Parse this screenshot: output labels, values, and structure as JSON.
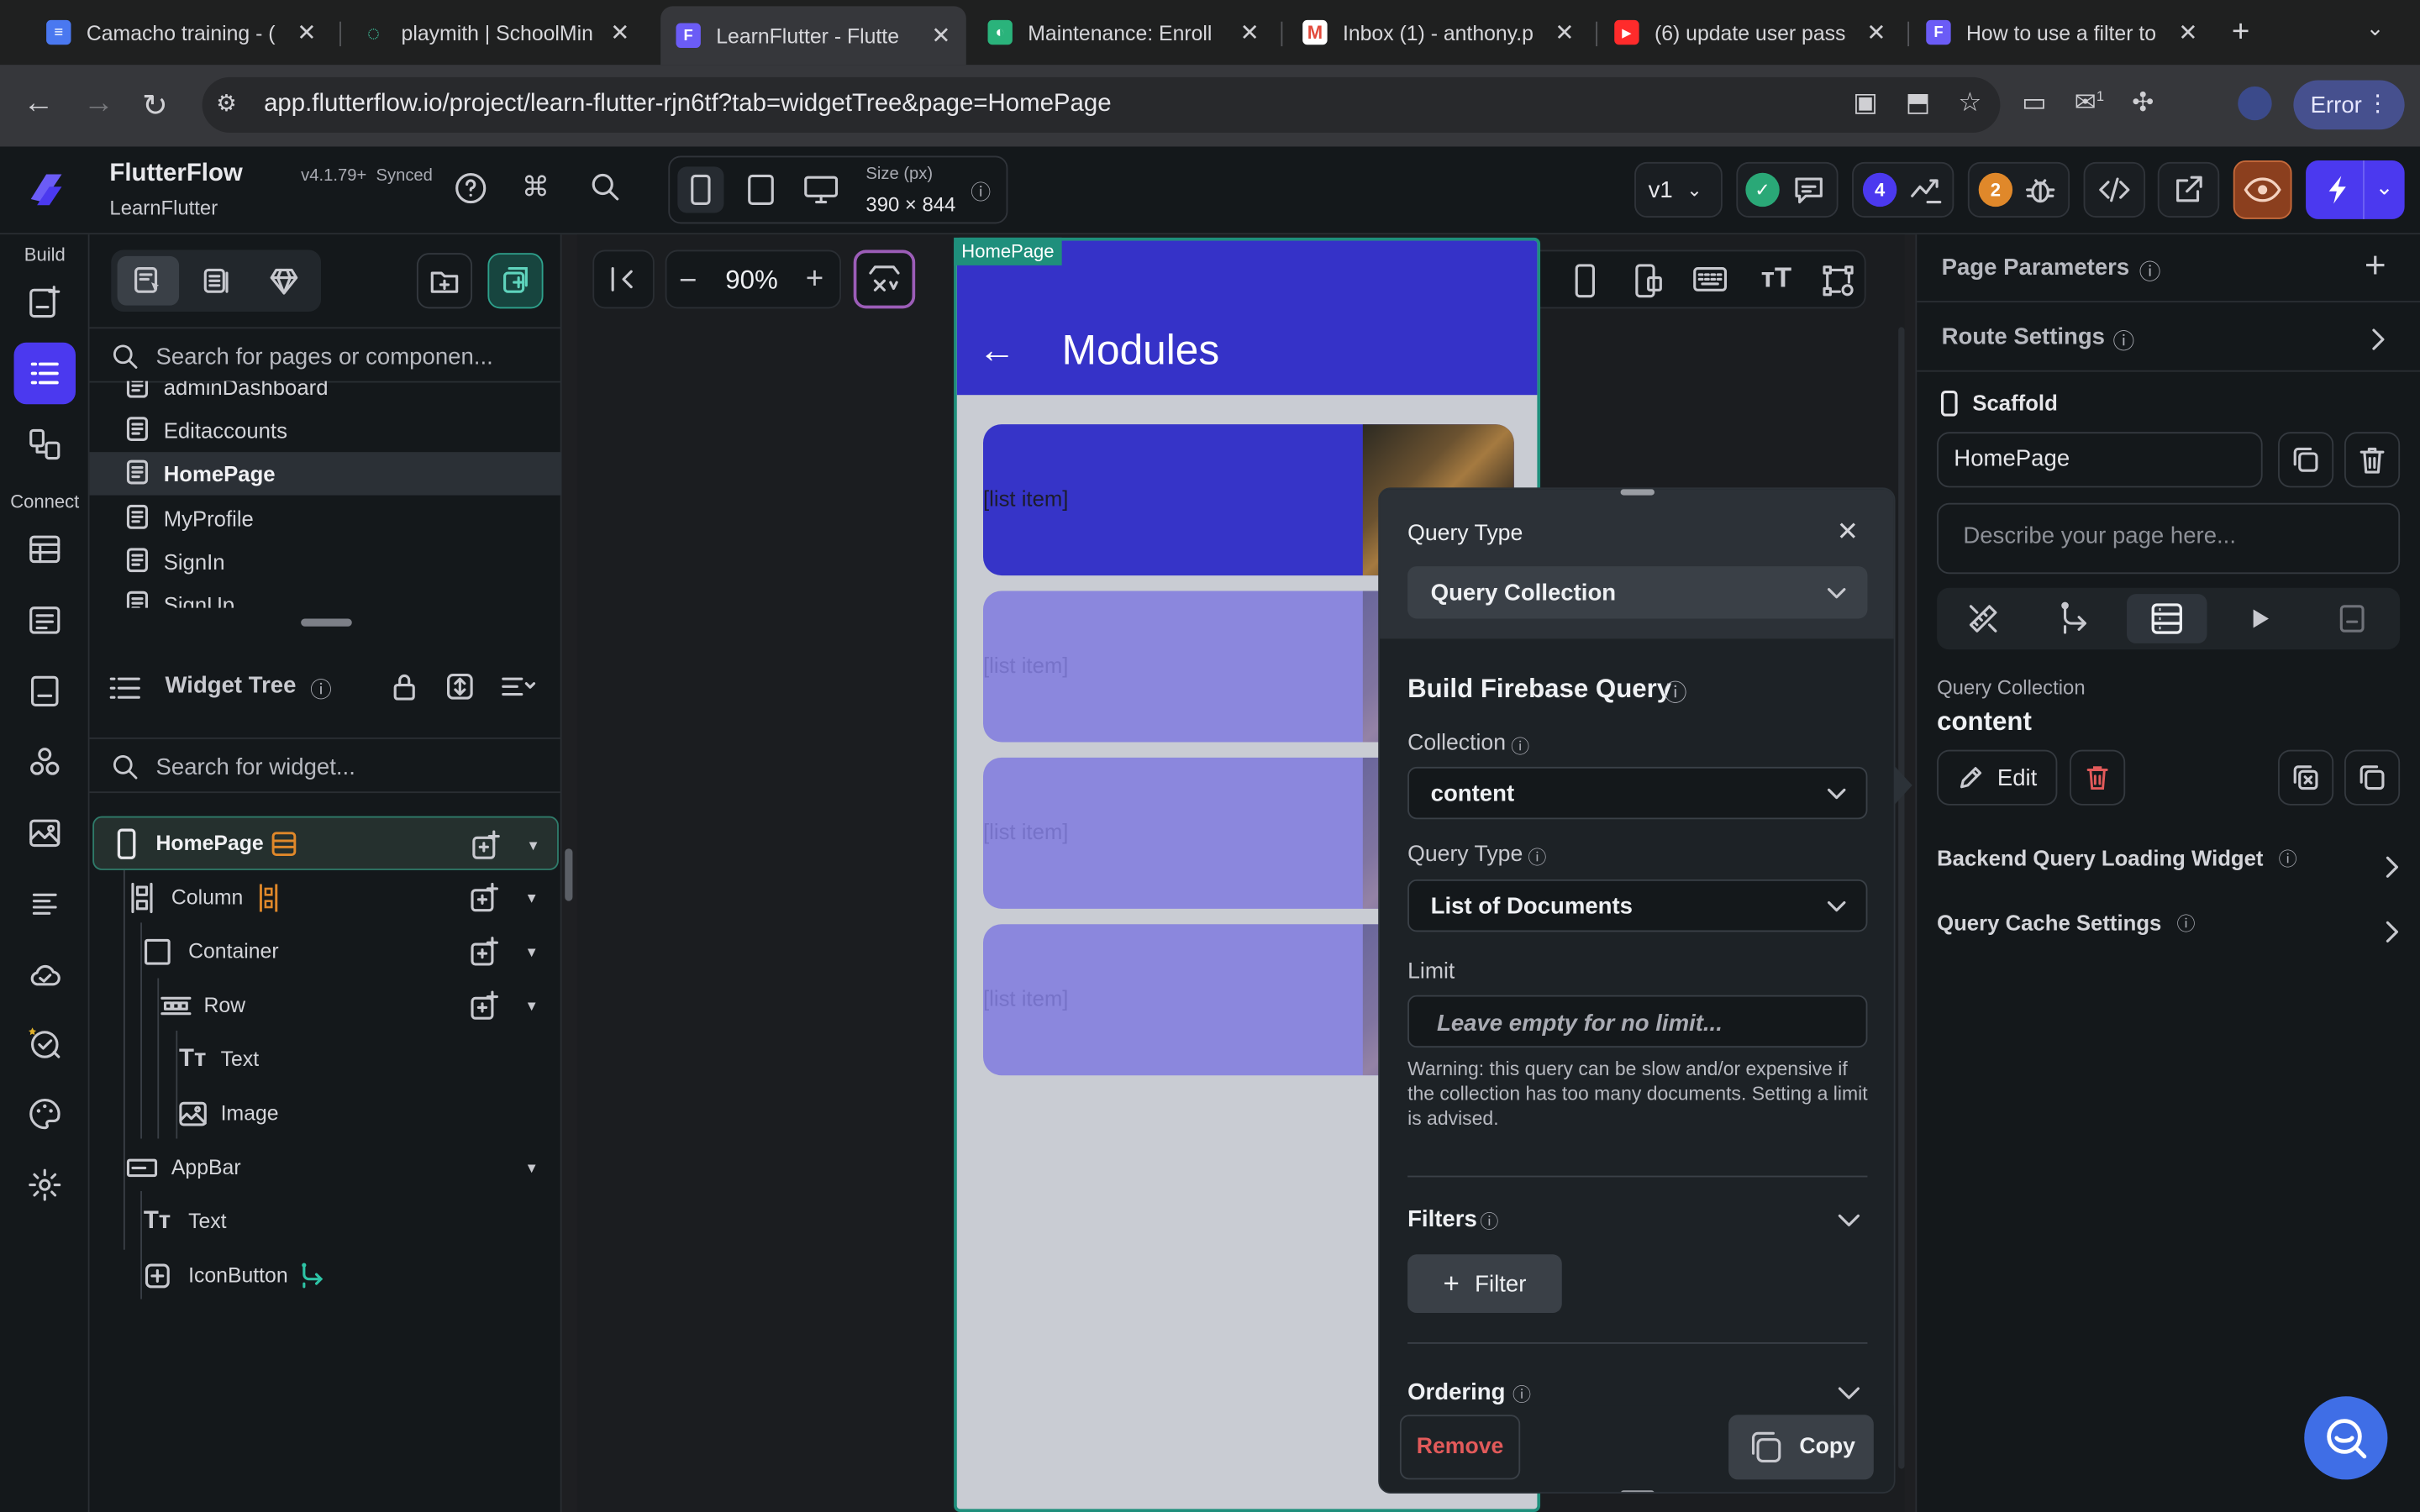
{
  "browser": {
    "tabs": [
      {
        "title": "Camacho training - (",
        "favicon_color": "#4a78f0"
      },
      {
        "title": "playmith | SchoolMin",
        "favicon_color": "#3fc6a0"
      },
      {
        "title": "LearnFlutter - Flutte",
        "favicon_color": "#6b5cf6"
      },
      {
        "title": "Maintenance: Enroll",
        "favicon_color": "#2ab37b"
      },
      {
        "title": "Inbox (1) - anthony.p",
        "favicon_color": "#e24a3b"
      },
      {
        "title": "(6) update user pass",
        "favicon_color": "#ff2b2b"
      },
      {
        "title": "How to use a filter to",
        "favicon_color": "#6b5cf6"
      }
    ],
    "url": "app.flutterflow.io/project/learn-flutter-rjn6tf?tab=widgetTree&page=HomePage",
    "error_label": "Error",
    "ext_badge": "1"
  },
  "header": {
    "app_name": "FlutterFlow",
    "version": "v4.1.79+",
    "sync": "Synced",
    "project": "LearnFlutter",
    "size_label": "Size (px)",
    "size_value": "390 × 844",
    "version_select": "v1",
    "badge_blue": "4",
    "badge_orange": "2"
  },
  "rail": {
    "build_label": "Build",
    "connect_label": "Connect"
  },
  "left_panel": {
    "page_search_placeholder": "Search for pages or componen...",
    "pages": [
      "adminDashboard",
      "Editaccounts",
      "HomePage",
      "MyProfile",
      "SignIn",
      "SignUp"
    ],
    "selected_page": "HomePage",
    "widget_tree_title": "Widget Tree",
    "widget_search_placeholder": "Search for widget...",
    "tree": [
      {
        "label": "HomePage"
      },
      {
        "label": "Column"
      },
      {
        "label": "Container"
      },
      {
        "label": "Row"
      },
      {
        "label": "Text"
      },
      {
        "label": "Image"
      },
      {
        "label": "AppBar"
      },
      {
        "label": "Text"
      },
      {
        "label": "IconButton"
      }
    ]
  },
  "canvas": {
    "zoom": "90%",
    "page_tag": "HomePage",
    "appbar_title": "Modules",
    "list_items": [
      "[list item]",
      "[list item]",
      "[list item]",
      "[list item]"
    ]
  },
  "query_popup": {
    "query_type_label": "Query Type",
    "query_type_value": "Query Collection",
    "build_title": "Build Firebase Query",
    "collection_label": "Collection",
    "collection_value": "content",
    "query_type2_label": "Query Type",
    "query_type2_value": "List of Documents",
    "limit_label": "Limit",
    "limit_placeholder": "Leave empty for no limit...",
    "warning": "Warning: this query can be slow and/or expensive if the collection has too many documents. Setting a limit is advised.",
    "filters_label": "Filters",
    "filter_button": "Filter",
    "ordering_label": "Ordering",
    "remove_label": "Remove",
    "copy_label": "Copy"
  },
  "right_panel": {
    "page_params": "Page Parameters",
    "route_settings": "Route Settings",
    "scaffold": "Scaffold",
    "page_name": "HomePage",
    "describe_placeholder": "Describe your page here...",
    "query_collection_label": "Query Collection",
    "query_collection_value": "content",
    "edit_label": "Edit",
    "loading_widget": "Backend Query Loading Widget",
    "cache_settings": "Query Cache Settings"
  },
  "colors": {
    "accent": "#4b39ef",
    "appbar": "#3532c8",
    "teal": "#1f8f7c",
    "danger": "#e25a5a"
  }
}
